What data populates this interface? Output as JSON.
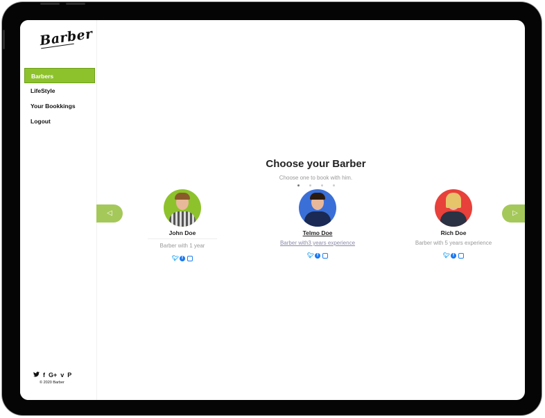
{
  "app": {
    "logo": "Barber",
    "copyright": "© 2020 Barber"
  },
  "sidebar": {
    "items": [
      {
        "label": "Barbers",
        "active": true
      },
      {
        "label": "LifeStyle",
        "active": false
      },
      {
        "label": "Your Bookkings",
        "active": false
      },
      {
        "label": "Logout",
        "active": false
      }
    ],
    "social": {
      "twitter": "🐦",
      "facebook": "f",
      "googleplus": "G+",
      "vimeo": "v",
      "pinterest": "P"
    }
  },
  "main": {
    "title": "Choose your Barber",
    "subtitle": "Choose one to book with him.",
    "prev_arrow": "◁",
    "next_arrow": "▷",
    "barbers": [
      {
        "name": "John Doe",
        "experience": "Barber with 1 year",
        "avatar_color": "#8dc22c"
      },
      {
        "name": "Telmo Doe",
        "experience": "Barber with3 years experience",
        "avatar_color": "#3b6fd8"
      },
      {
        "name": "Rich Doe",
        "experience": "Barber with 5 years experience",
        "avatar_color": "#e8403a"
      }
    ],
    "icons": {
      "twitter": "twitter-icon",
      "facebook": "facebook-icon",
      "instagram": "instagram-icon"
    }
  },
  "colors": {
    "accent": "#8dc22c",
    "arrow": "#a5c85a"
  }
}
